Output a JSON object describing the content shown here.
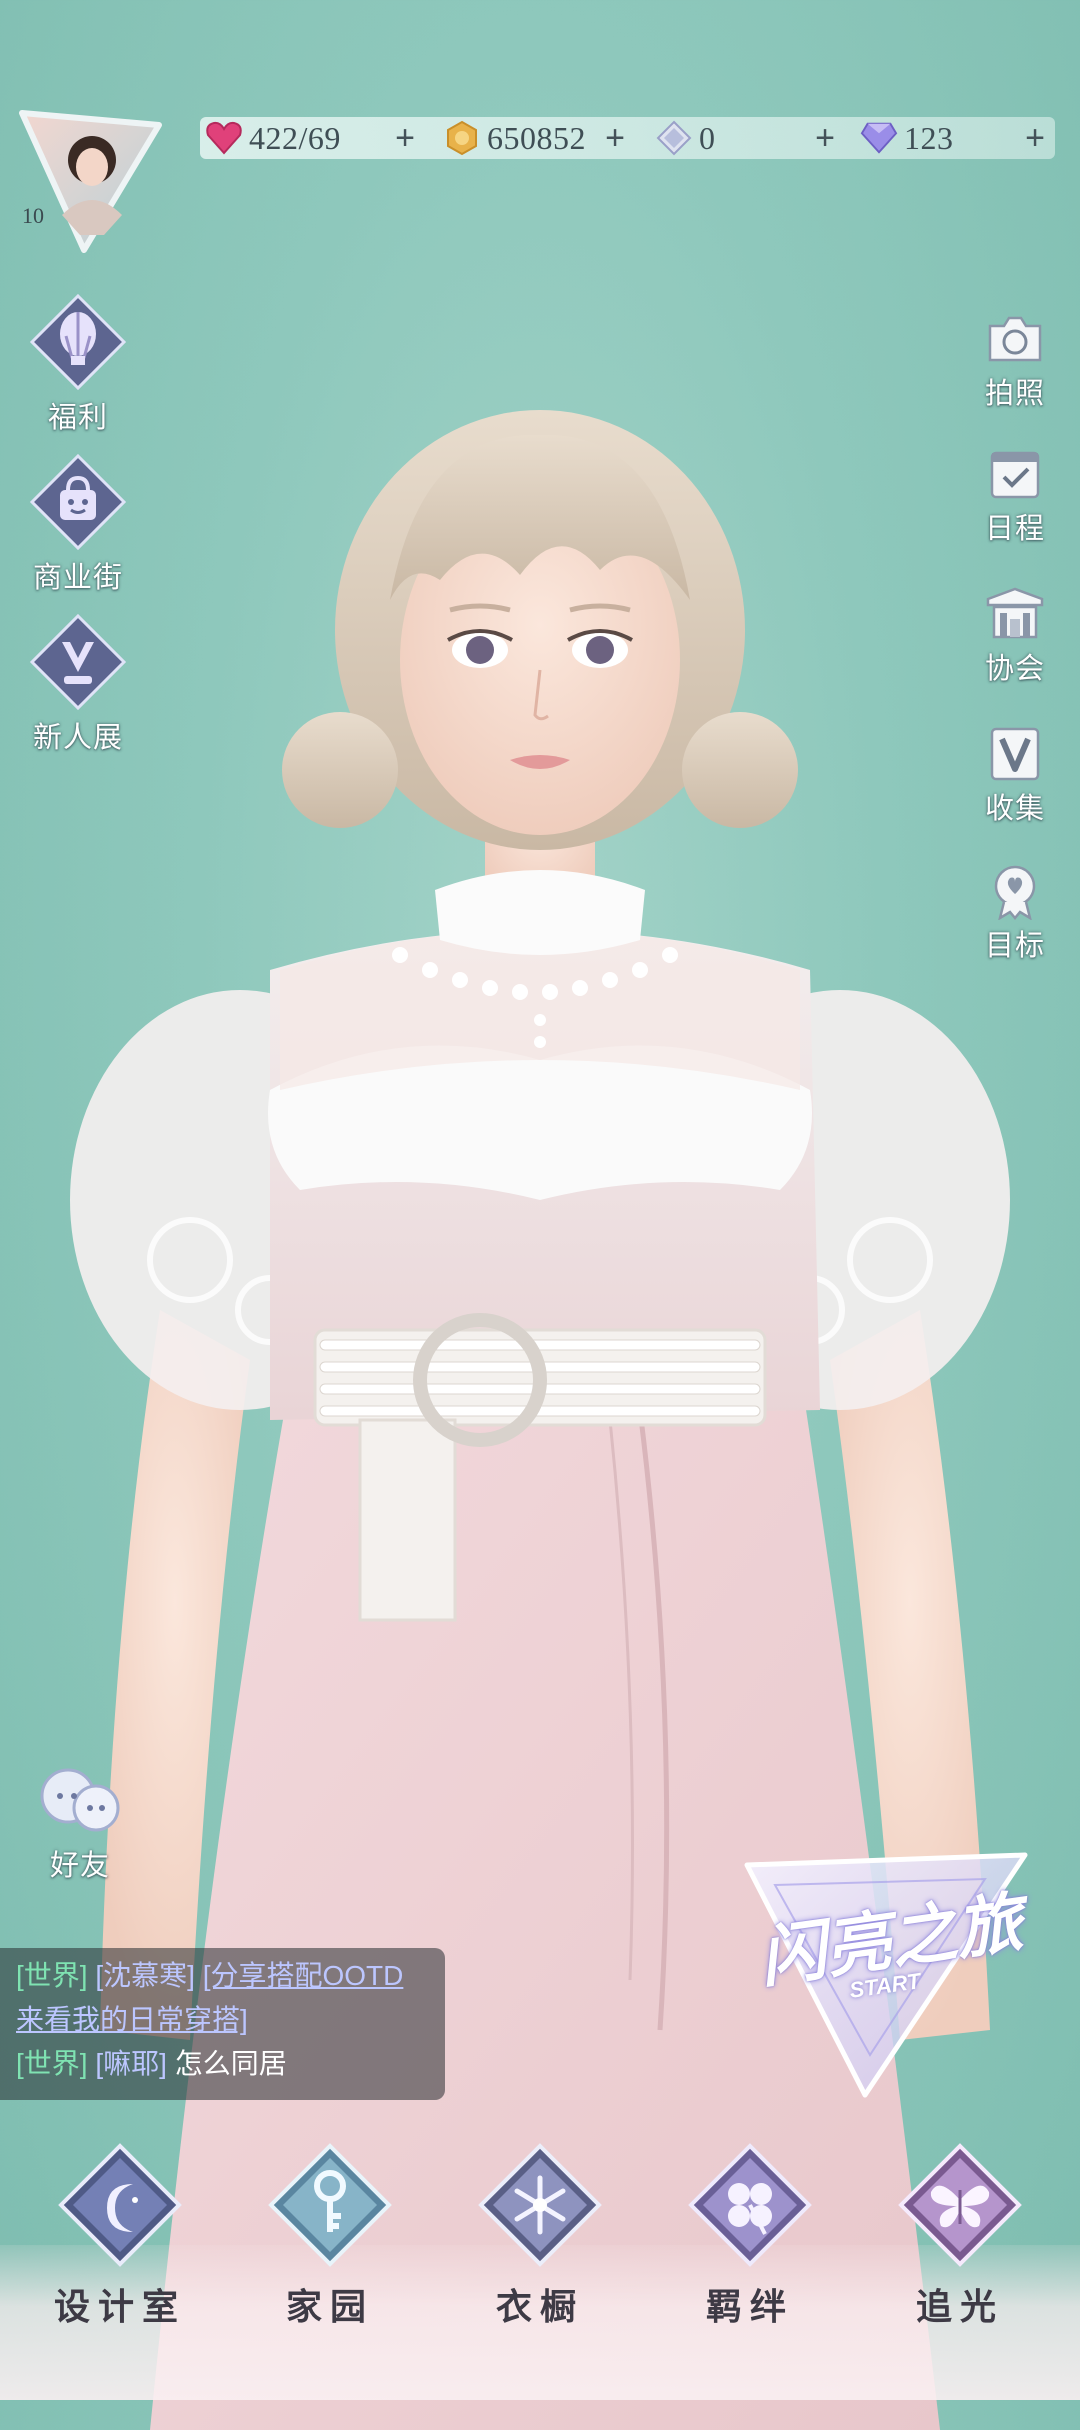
{
  "player": {
    "level": "10"
  },
  "currencies": [
    {
      "id": "stamina",
      "value": "422/69",
      "icon": "heart-gem-icon",
      "color": "#e0417a"
    },
    {
      "id": "coins",
      "value": "650852",
      "icon": "gold-coin-icon",
      "color": "#e8b24a"
    },
    {
      "id": "crystal",
      "value": "0",
      "icon": "crystal-icon",
      "color": "#9aa0c8"
    },
    {
      "id": "diamond",
      "value": "123",
      "icon": "diamond-icon",
      "color": "#8a7de0"
    }
  ],
  "plus_symbol": "+",
  "left_menu": [
    {
      "label": "福利",
      "icon": "hot-air-balloon-icon"
    },
    {
      "label": "商业街",
      "icon": "shopping-bag-icon"
    },
    {
      "label": "新人展",
      "icon": "trophy-icon"
    }
  ],
  "right_menu": [
    {
      "label": "拍照",
      "icon": "camera-icon"
    },
    {
      "label": "日程",
      "icon": "calendar-check-icon"
    },
    {
      "label": "协会",
      "icon": "building-icon"
    },
    {
      "label": "收集",
      "icon": "collection-v-icon"
    },
    {
      "label": "目标",
      "icon": "medal-icon"
    }
  ],
  "friends": {
    "label": "好友",
    "icon": "friends-icon"
  },
  "chat": {
    "line1_channel": "[世界]",
    "line1_name": "[沈慕寒]",
    "line1_link_a": "[分享搭配OOTD",
    "line1_link_b": "来看我的日常穿搭]",
    "line2_channel": "[世界]",
    "line2_name": "[嘛耶]",
    "line2_text": "怎么同居"
  },
  "banner": {
    "title": "闪亮之旅",
    "subtitle": "START"
  },
  "bottom_nav": [
    {
      "label": "设计室",
      "icon": "moon-icon"
    },
    {
      "label": "家园",
      "icon": "key-icon"
    },
    {
      "label": "衣橱",
      "icon": "snowflake-icon"
    },
    {
      "label": "羁绊",
      "icon": "clover-icon"
    },
    {
      "label": "追光",
      "icon": "butterfly-icon"
    }
  ],
  "colors": {
    "background": "#8ec8bc",
    "chat_channel": "#7fe3b2",
    "chat_name": "#bcc6ff"
  }
}
